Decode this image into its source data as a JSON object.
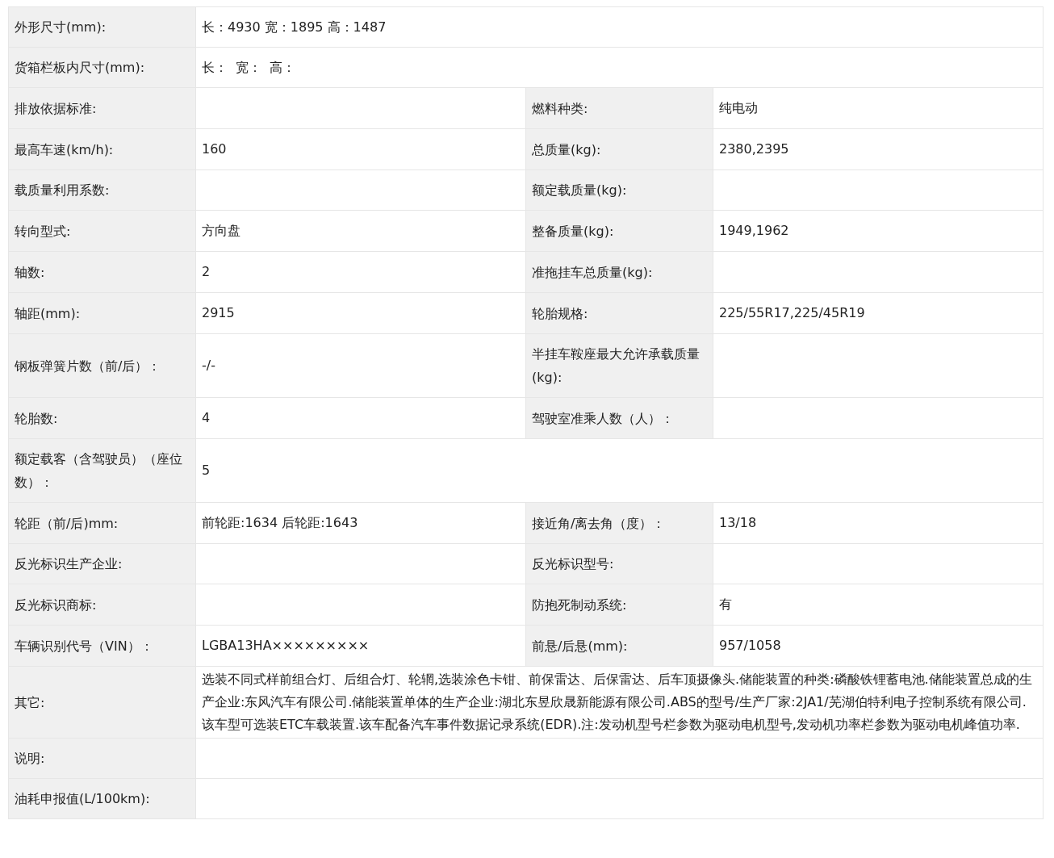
{
  "rows": [
    {
      "cells": [
        {
          "kind": "label",
          "text": "外形尺寸(mm):"
        },
        {
          "kind": "wide_value",
          "text": "长：4930 宽：1895 高：1487"
        }
      ]
    },
    {
      "cells": [
        {
          "kind": "label",
          "text": "货箱栏板内尺寸(mm):"
        },
        {
          "kind": "wide_value",
          "text": "长：  宽：  高："
        }
      ]
    },
    {
      "cells": [
        {
          "kind": "label",
          "text": "排放依据标准:"
        },
        {
          "kind": "value"
        },
        {
          "kind": "label",
          "text": "燃料种类:"
        },
        {
          "kind": "value",
          "text": "纯电动"
        }
      ]
    },
    {
      "cells": [
        {
          "kind": "label",
          "text": "最高车速(km/h):"
        },
        {
          "kind": "value",
          "text": "160"
        },
        {
          "kind": "label",
          "text": "总质量(kg):"
        },
        {
          "kind": "value",
          "text": "2380,2395"
        }
      ]
    },
    {
      "cells": [
        {
          "kind": "label",
          "text": "载质量利用系数:"
        },
        {
          "kind": "value"
        },
        {
          "kind": "label",
          "text": "额定载质量(kg):"
        },
        {
          "kind": "value"
        }
      ]
    },
    {
      "cells": [
        {
          "kind": "label",
          "text": "转向型式:"
        },
        {
          "kind": "value",
          "text": "方向盘"
        },
        {
          "kind": "label",
          "text": "整备质量(kg):"
        },
        {
          "kind": "value",
          "text": "1949,1962"
        }
      ]
    },
    {
      "cells": [
        {
          "kind": "label",
          "text": "轴数:"
        },
        {
          "kind": "value",
          "text": "2"
        },
        {
          "kind": "label",
          "text": "准拖挂车总质量(kg):"
        },
        {
          "kind": "value"
        }
      ]
    },
    {
      "cells": [
        {
          "kind": "label",
          "text": "轴距(mm):"
        },
        {
          "kind": "value",
          "text": "2915"
        },
        {
          "kind": "label",
          "text": "轮胎规格:"
        },
        {
          "kind": "value",
          "text": "225/55R17,225/45R19"
        }
      ]
    },
    {
      "cells": [
        {
          "kind": "label",
          "text": "钢板弹簧片数（前/后）："
        },
        {
          "kind": "value",
          "text": "-/-"
        },
        {
          "kind": "label",
          "text": "半挂车鞍座最大允许承载质量(kg):"
        },
        {
          "kind": "value"
        }
      ]
    },
    {
      "cells": [
        {
          "kind": "label",
          "text": "轮胎数:"
        },
        {
          "kind": "value",
          "text": "4"
        },
        {
          "kind": "label",
          "text": "驾驶室准乘人数（人）："
        },
        {
          "kind": "value"
        }
      ]
    },
    {
      "cells": [
        {
          "kind": "label",
          "text": "额定载客（含驾驶员）（座位数）："
        },
        {
          "kind": "wide_value",
          "text": "5"
        }
      ]
    },
    {
      "cells": [
        {
          "kind": "label",
          "text": "轮距（前/后)mm:"
        },
        {
          "kind": "value",
          "text": "前轮距:1634 后轮距:1643"
        },
        {
          "kind": "label",
          "text": "接近角/离去角（度）："
        },
        {
          "kind": "value",
          "text": "13/18"
        }
      ]
    },
    {
      "cells": [
        {
          "kind": "label",
          "text": "反光标识生产企业:"
        },
        {
          "kind": "value"
        },
        {
          "kind": "label",
          "text": "反光标识型号:"
        },
        {
          "kind": "value"
        }
      ]
    },
    {
      "cells": [
        {
          "kind": "label",
          "text": "反光标识商标:"
        },
        {
          "kind": "value"
        },
        {
          "kind": "label",
          "text": "防抱死制动系统:"
        },
        {
          "kind": "value",
          "text": "有"
        }
      ]
    },
    {
      "cells": [
        {
          "kind": "label",
          "text": "车辆识别代号（VIN）："
        },
        {
          "kind": "value",
          "text": "LGBA13HA×××××××××"
        },
        {
          "kind": "label",
          "text": "前悬/后悬(mm):"
        },
        {
          "kind": "value",
          "text": "957/1058"
        }
      ]
    },
    {
      "cells": [
        {
          "kind": "label",
          "text": "其它:"
        },
        {
          "kind": "wide_value",
          "text": "选装不同式样前组合灯、后组合灯、轮辋,选装涂色卡钳、前保雷达、后保雷达、后车顶摄像头.储能装置的种类:磷酸铁锂蓄电池.储能装置总成的生产企业:东风汽车有限公司.储能装置单体的生产企业:湖北东昱欣晟新能源有限公司.ABS的型号/生产厂家:2JA1/芜湖伯特利电子控制系统有限公司.该车型可选装ETC车载装置.该车配备汽车事件数据记录系统(EDR).注:发动机型号栏参数为驱动电机型号,发动机功率栏参数为驱动电机峰值功率."
        }
      ]
    },
    {
      "cells": [
        {
          "kind": "label",
          "text": "说明:"
        },
        {
          "kind": "wide_value"
        }
      ]
    },
    {
      "cells": [
        {
          "kind": "label",
          "text": "油耗申报值(L/100km):"
        },
        {
          "kind": "wide_value"
        }
      ]
    }
  ]
}
